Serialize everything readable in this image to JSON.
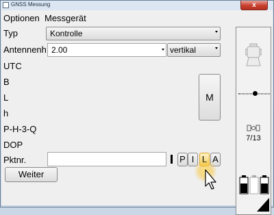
{
  "window": {
    "title": "GNSS Messung",
    "close_symbol": "x"
  },
  "menu": {
    "optionen": "Optionen",
    "messgeraet": "Messgerät"
  },
  "form": {
    "typ_label": "Typ",
    "typ_value": "Kontrolle",
    "antenne_label": "Antennenh",
    "antenne_value": "2.00",
    "antenne_mode": "vertikal",
    "utc_label": "UTC",
    "b_label": "B",
    "l_label": "L",
    "h_label": "h",
    "phq_label": "P-H-3-Q",
    "dop_label": "DOP",
    "pktnr_label": "Pktnr.",
    "pktnr_value": ""
  },
  "buttons": {
    "m": "M",
    "p": "P",
    "i": "I",
    "l": "L",
    "a": "A",
    "weiter": "Weiter"
  },
  "side": {
    "counter": "7/13"
  },
  "colors": {
    "title_bar": "#c9d7e6",
    "close_button": "#c63f2e",
    "cursor_highlight": "#f7c640"
  }
}
